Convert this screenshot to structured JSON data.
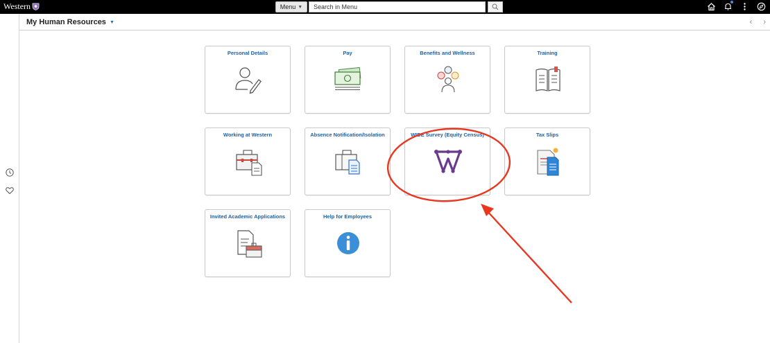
{
  "topbar": {
    "brand": "Western",
    "menu_label": "Menu",
    "search_value": "Search in Menu"
  },
  "header": {
    "title": "My Human Resources"
  },
  "tiles": [
    {
      "label": "Personal Details",
      "icon": "person-edit-icon"
    },
    {
      "label": "Pay",
      "icon": "money-icon"
    },
    {
      "label": "Benefits and Wellness",
      "icon": "benefits-icon"
    },
    {
      "label": "Training",
      "icon": "book-icon"
    },
    {
      "label": "Working at Western",
      "icon": "briefcase-document-icon"
    },
    {
      "label": "Absence Notification/Isolation",
      "icon": "documents-icon"
    },
    {
      "label": "WIDE Survey (Equity Census)",
      "icon": "wide-survey-icon"
    },
    {
      "label": "Tax Slips",
      "icon": "tax-slips-icon"
    },
    {
      "label": "Invited Academic Applications",
      "icon": "document-briefcase-icon"
    },
    {
      "label": "Help for Employees",
      "icon": "info-icon"
    }
  ],
  "colors": {
    "tile_title": "#1d5fa6",
    "annotation": "#e8361f",
    "wide_icon": "#6b3a8e",
    "info_icon": "#3a8fd6"
  }
}
